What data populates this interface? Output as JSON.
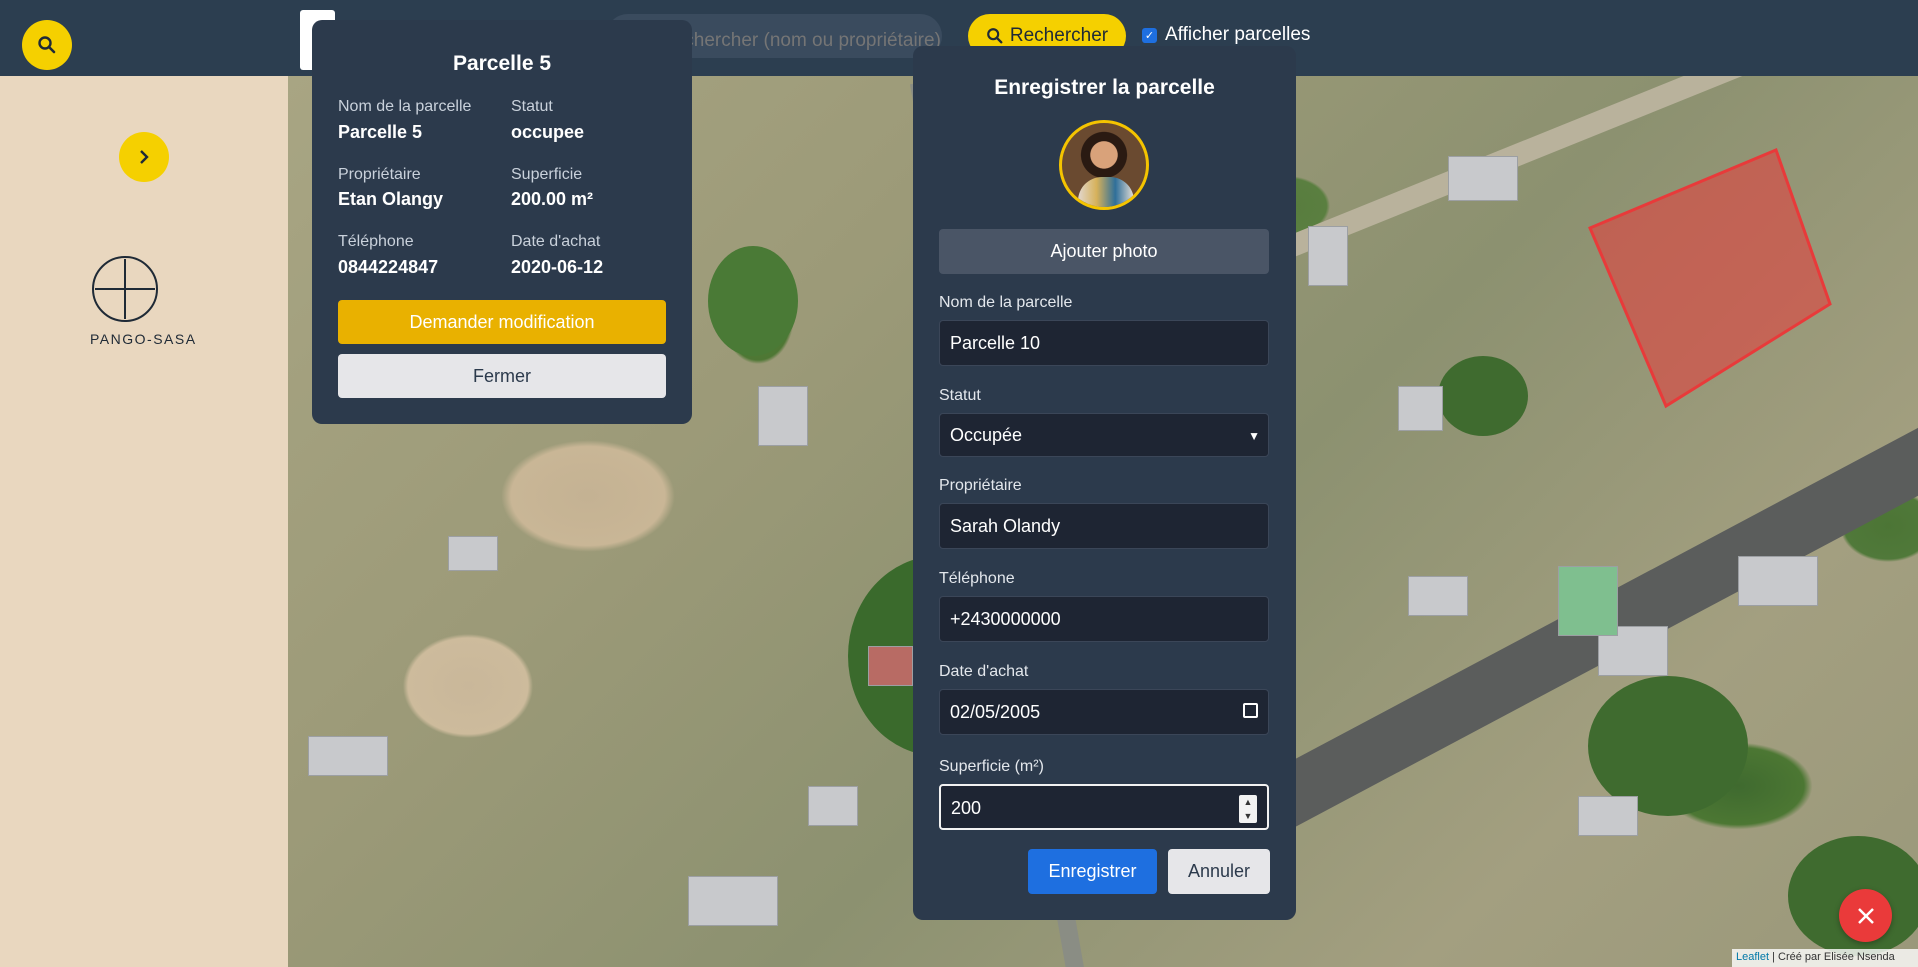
{
  "header": {
    "search_placeholder": "Rechercher (nom ou propriétaire)",
    "search_button": "Rechercher",
    "show_parcels_label": "Afficher parcelles",
    "show_parcels_checked": true
  },
  "sidebar": {
    "logo_text": "PANGO-SASA"
  },
  "info_card": {
    "title": "Parcelle 5",
    "fields": [
      {
        "label": "Nom de la parcelle",
        "value": "Parcelle 5"
      },
      {
        "label": "Statut",
        "value": "occupee"
      },
      {
        "label": "Propriétaire",
        "value": "Etan Olangy"
      },
      {
        "label": "Superficie",
        "value": "200.00 m²"
      },
      {
        "label": "Téléphone",
        "value": "0844224847"
      },
      {
        "label": "Date d'achat",
        "value": "2020-06-12"
      }
    ],
    "request_button": "Demander modification",
    "close_button": "Fermer"
  },
  "form_card": {
    "title": "Enregistrer la parcelle",
    "add_photo_button": "Ajouter photo",
    "fields": {
      "name": {
        "label": "Nom de la parcelle",
        "value": "Parcelle 10"
      },
      "status": {
        "label": "Statut",
        "value": "Occupée"
      },
      "owner": {
        "label": "Propriétaire",
        "value": "Sarah Olandy"
      },
      "phone": {
        "label": "Téléphone",
        "value": "+2430000000"
      },
      "date": {
        "label": "Date d'achat",
        "value": "02/05/2005"
      },
      "area": {
        "label": "Superficie (m²)",
        "value": "200"
      }
    },
    "save_button": "Enregistrer",
    "cancel_button": "Annuler"
  },
  "map": {
    "attribution_link": "Leaflet",
    "attribution_text": " | Créé par Elisée Nsenda",
    "parcel_color": "#e83a3a"
  },
  "colors": {
    "header_bg": "#2c3e50",
    "accent_yellow": "#f5d000",
    "primary_blue": "#1e6fe0",
    "danger_red": "#ea3a3a"
  },
  "icons": {
    "search": "search-icon",
    "arrow": "chevron-right-icon",
    "logo": "plus-circle-icon",
    "close": "close-icon",
    "calendar": "calendar-icon",
    "select": "chevron-down-icon"
  }
}
